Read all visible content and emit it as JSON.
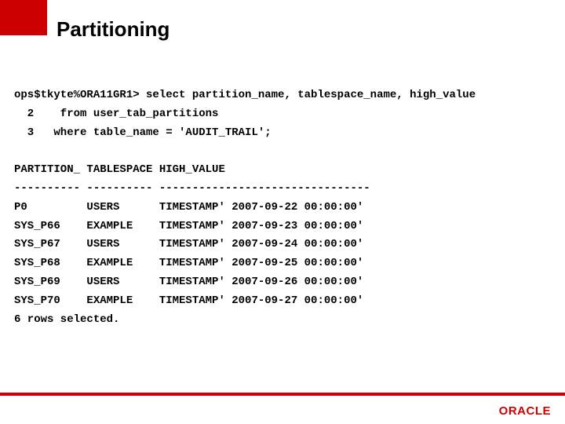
{
  "title": "Partitioning",
  "sql": {
    "prompt": "ops$tkyte%ORA11GR1> select partition_name, tablespace_name, high_value",
    "line2": "  2    from user_tab_partitions",
    "line3": "  3   where table_name = 'AUDIT_TRAIL';"
  },
  "header": "PARTITION_ TABLESPACE HIGH_VALUE",
  "divider": "---------- ---------- --------------------------------",
  "rows": [
    "P0         USERS      TIMESTAMP' 2007-09-22 00:00:00'",
    "SYS_P66    EXAMPLE    TIMESTAMP' 2007-09-23 00:00:00'",
    "SYS_P67    USERS      TIMESTAMP' 2007-09-24 00:00:00'",
    "SYS_P68    EXAMPLE    TIMESTAMP' 2007-09-25 00:00:00'",
    "SYS_P69    USERS      TIMESTAMP' 2007-09-26 00:00:00'",
    "SYS_P70    EXAMPLE    TIMESTAMP' 2007-09-27 00:00:00'"
  ],
  "footer": "6 rows selected.",
  "logo": "ORACLE"
}
